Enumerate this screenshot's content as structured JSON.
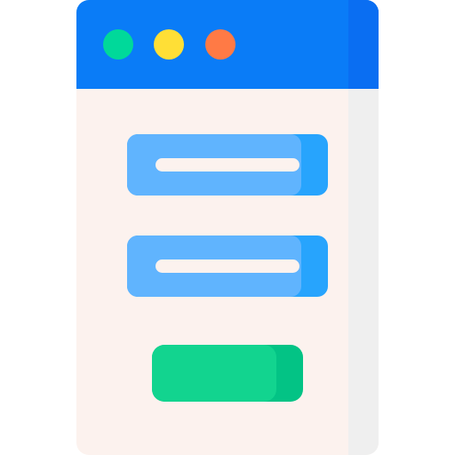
{
  "colors": {
    "window_body": "#fcf2ee",
    "window_side": "#efefef",
    "titlebar": "#0a7cf7",
    "titlebar_side": "#0a6ef2",
    "dot_green": "#00d99a",
    "dot_yellow": "#ffdf36",
    "dot_orange": "#ff7a45",
    "field_light": "#60b4fe",
    "field_dark": "#27a4fd",
    "field_line": "#fcf2ee",
    "button_light": "#12d48f",
    "button_dark": "#03c385"
  },
  "window": {
    "controls": [
      {
        "name": "window-control-green-dot",
        "color": "#00d99a"
      },
      {
        "name": "window-control-yellow-dot",
        "color": "#ffdf36"
      },
      {
        "name": "window-control-orange-dot",
        "color": "#ff7a45"
      }
    ]
  },
  "form": {
    "fields": [
      {
        "name": "input-field-1",
        "icon": "text-line"
      },
      {
        "name": "input-field-2",
        "icon": "text-line"
      }
    ],
    "submit": {
      "name": "submit-button"
    }
  }
}
